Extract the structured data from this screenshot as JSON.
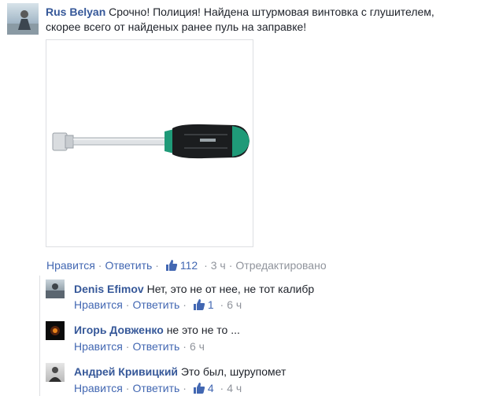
{
  "main_comment": {
    "author": "Rus Belyan",
    "text_line1": "Срочно! Полиция! Найдена штурмовая винтовка с глушителем,",
    "text_line2": "скорее всего от найденых ранее пуль на заправке!",
    "actions": {
      "like": "Нравится",
      "reply": "Ответить",
      "likes_count": "112",
      "time": "3 ч",
      "edited": "Отредактировано"
    }
  },
  "replies": [
    {
      "author": "Denis Efimov",
      "text": "Нет, это не от нее, не тот калибр",
      "like": "Нравится",
      "reply": "Ответить",
      "likes_count": "1",
      "time": "6 ч"
    },
    {
      "author": "Игорь Довженко",
      "text": "не это не то ...",
      "like": "Нравится",
      "reply": "Ответить",
      "time": "6 ч"
    },
    {
      "author": "Андрей Кривицкий",
      "text": "Это был, шурупомет",
      "like": "Нравится",
      "reply": "Ответить",
      "likes_count": "4",
      "time": "4 ч"
    }
  ],
  "colors": {
    "name": "#365899",
    "link": "#4267b2",
    "meta": "#90949c",
    "handle_green": "#1f9a78"
  }
}
